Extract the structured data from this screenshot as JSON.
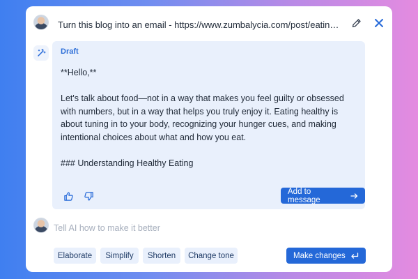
{
  "header": {
    "prompt": "Turn this blog into an email - https://www.zumbalycia.com/post/eating-healthy",
    "edit_icon": "pencil-icon",
    "close_icon": "close-icon"
  },
  "draft": {
    "label": "Draft",
    "paragraphs": [
      "**Hello,**",
      "Let's talk about food—not in a way that makes you feel guilty or obsessed with numbers, but in a way that helps you truly enjoy it. Eating healthy is about tuning in to your body, recognizing your hunger cues, and making intentional choices about what and how you eat.",
      "### Understanding Healthy Eating"
    ],
    "add_button": "Add to message",
    "thumbs_up_icon": "thumbs-up-icon",
    "thumbs_down_icon": "thumbs-down-icon"
  },
  "refine": {
    "placeholder": "Tell AI how to make it better",
    "chips": [
      "Elaborate",
      "Simplify",
      "Shorten",
      "Change tone"
    ],
    "submit_button": "Make changes"
  },
  "colors": {
    "accent": "#2468d8",
    "draft_bg": "#e9f0fc"
  }
}
